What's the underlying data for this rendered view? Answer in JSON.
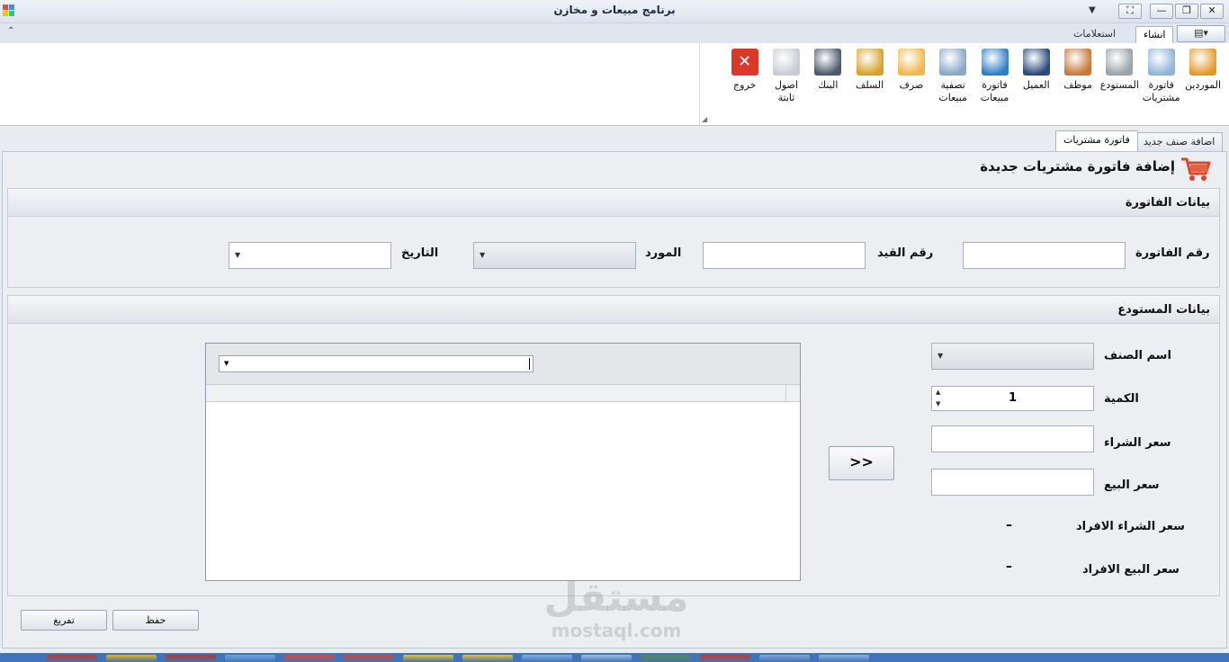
{
  "window": {
    "title": "برنامج مبيعات و مخازن",
    "minimize": "—",
    "restore": "❐",
    "close": "✕",
    "fullscreen": "⛶",
    "quick_access": "▼"
  },
  "ribbon": {
    "tabs": [
      {
        "label": "انشاء",
        "active": true
      },
      {
        "label": "استعلامات",
        "active": false
      }
    ],
    "app_menu": "▤▾",
    "collapse": "⌃",
    "buttons": [
      {
        "label": "الموردين",
        "icon": "box-icon",
        "color": "#e39a2c"
      },
      {
        "label": "فاتورة مشتريات",
        "icon": "invoice-calculator-icon",
        "color": "#8fb6d9"
      },
      {
        "label": "المستودع",
        "icon": "warehouse-icon",
        "color": "#9aa3a8"
      },
      {
        "label": "موظف",
        "icon": "employee-desk-icon",
        "color": "#c9783a"
      },
      {
        "label": "العميل",
        "icon": "customer-icon",
        "color": "#2b4a7d"
      },
      {
        "label": "فاتورة مبيعات",
        "icon": "price-tag-icon",
        "color": "#2f7fc4"
      },
      {
        "label": "تصفية مبيعات",
        "icon": "filter-icon",
        "color": "#8aa7c7"
      },
      {
        "label": "صرف",
        "icon": "upload-box-icon",
        "color": "#f0b84a"
      },
      {
        "label": "السلف",
        "icon": "coins-icon",
        "color": "#d9a22a"
      },
      {
        "label": "البنك",
        "icon": "safe-icon",
        "color": "#4c5a6c"
      },
      {
        "label": "اصول ثابتة",
        "icon": "document-icon",
        "color": "#c8ccd2"
      },
      {
        "label": "خروج",
        "icon": "close-icon",
        "color": "#d9392b"
      }
    ]
  },
  "doc_tabs": [
    {
      "label": "اضافة صنف جديد",
      "active": false
    },
    {
      "label": "فاتورة مشتريات",
      "active": true
    }
  ],
  "page": {
    "title": "إضافة فاتورة مشتريات جديدة"
  },
  "invoice_section": {
    "title": "بيانات الفاتورة",
    "invoice_number_label": "رقم الفاتورة",
    "invoice_number_value": "",
    "entry_number_label": "رقم القيد",
    "entry_number_value": "",
    "supplier_label": "المورد",
    "supplier_value": "",
    "date_label": "التاريخ",
    "date_value": ""
  },
  "warehouse_section": {
    "title": "بيانات المستودع",
    "item_name_label": "اسم الصنف",
    "item_name_value": "",
    "quantity_label": "الكمية",
    "quantity_value": "1",
    "purchase_price_label": "سعر الشراء",
    "purchase_price_value": "",
    "sale_price_label": "سعر البيع",
    "sale_price_value": "",
    "unit_purchase_price_label": "سعر الشراء الافراد",
    "unit_purchase_price_value": "–",
    "unit_sale_price_label": "سعر البيع الافراد",
    "unit_sale_price_value": "–",
    "add_button": ">>"
  },
  "actions": {
    "save": "حفظ",
    "clear": "تفريغ"
  },
  "watermark": {
    "arabic": "مستقل",
    "latin": "mostaql.com"
  },
  "taskbar": {
    "colors": [
      "#c0392b",
      "#e6b422",
      "#b03a2e",
      "#6aa8d8",
      "#d84a3a",
      "#c94a3a",
      "#e8c23a",
      "#e8c23a",
      "#7fb0de",
      "#9cc0e4",
      "#5a8a4a",
      "#c83a2a",
      "#7fa8d4",
      "#8fb4dc"
    ]
  }
}
